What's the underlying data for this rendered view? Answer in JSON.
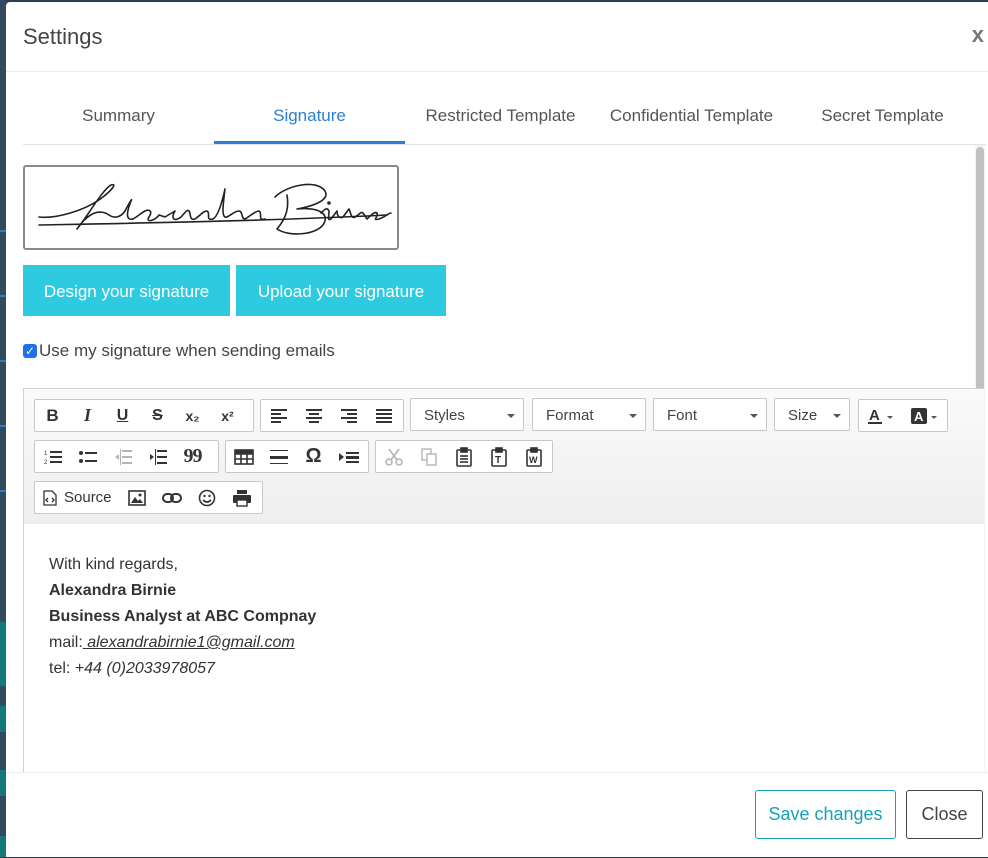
{
  "modal": {
    "title": "Settings",
    "close_glyph": "x"
  },
  "tabs": [
    {
      "label": "Summary"
    },
    {
      "label": "Signature"
    },
    {
      "label": "Restricted Template"
    },
    {
      "label": "Confidential Template"
    },
    {
      "label": "Secret Template"
    }
  ],
  "active_tab": "Signature",
  "signature": {
    "image_name": "Alexandra Birnie",
    "design_label": "Design your signature",
    "upload_label": "Upload your signature",
    "use_in_emails_label": "Use my signature when sending emails",
    "use_in_emails_checked": true
  },
  "toolbar": {
    "styles_label": "Styles",
    "format_label": "Format",
    "font_label": "Font",
    "size_label": "Size",
    "source_label": "Source",
    "icons": {
      "bold": "B",
      "italic": "I",
      "underline": "U",
      "strike": "S",
      "subscript": "x₂",
      "superscript": "x²",
      "blockquote": "99",
      "special_char": "Ω"
    }
  },
  "body": {
    "line1": "With kind regards,",
    "name": "Alexandra Birnie",
    "role": "Business Analyst at ABC Compnay",
    "mail_prefix": "mail:",
    "mail": " alexandrabirnie1@gmail.com",
    "tel_prefix": "tel: ",
    "tel": "+44 (0)2033978057"
  },
  "footer": {
    "save_label": "Save changes",
    "close_label": "Close"
  },
  "colors": {
    "accent": "#2a7fd4",
    "cyan_button": "#2ecbe0",
    "save_outline": "#17a2b8"
  }
}
